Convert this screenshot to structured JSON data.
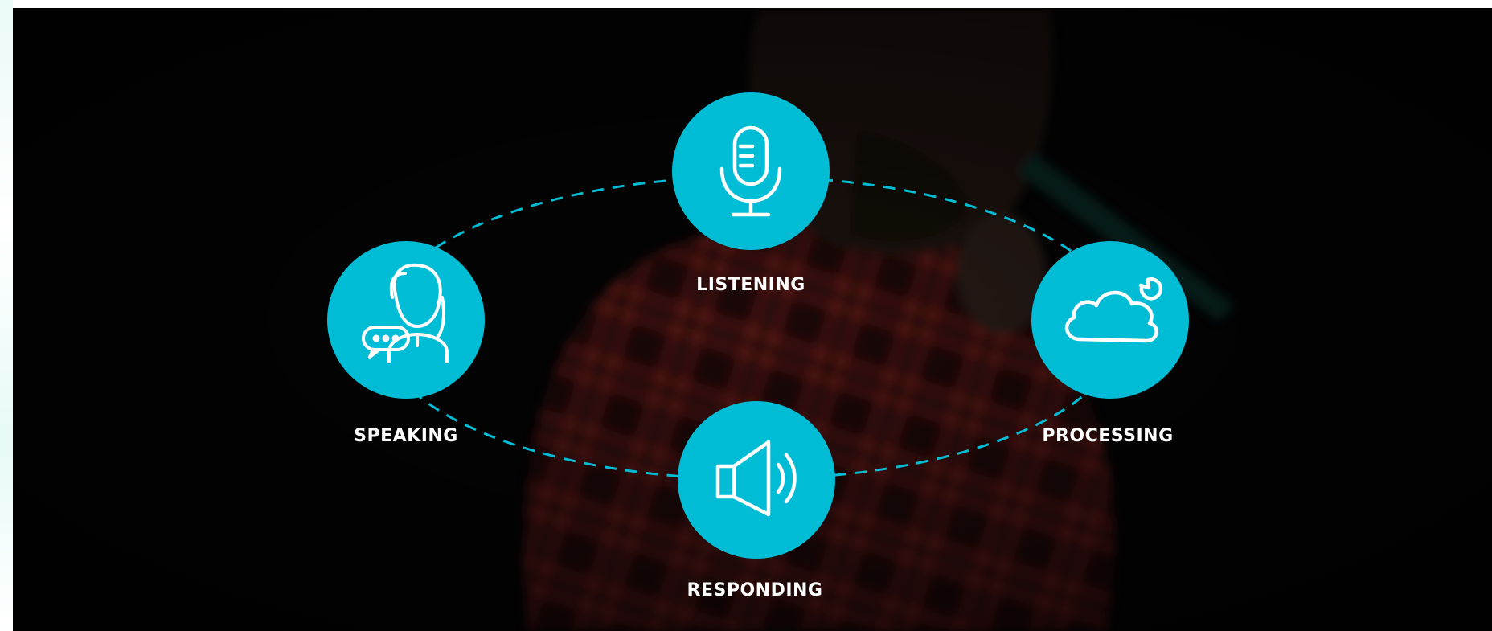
{
  "colors": {
    "accent": "#00BCD4",
    "background": "#050506",
    "label": "#FFFFFF",
    "shirt_red": "#7A1F1A"
  },
  "nodes": [
    {
      "id": "listening",
      "label": "LISTENING",
      "icon": "microphone-icon"
    },
    {
      "id": "processing",
      "label": "PROCESSING",
      "icon": "cloud-sync-icon"
    },
    {
      "id": "responding",
      "label": "RESPONDING",
      "icon": "speaker-icon"
    },
    {
      "id": "speaking",
      "label": "SPEAKING",
      "icon": "speaking-person-icon"
    }
  ]
}
